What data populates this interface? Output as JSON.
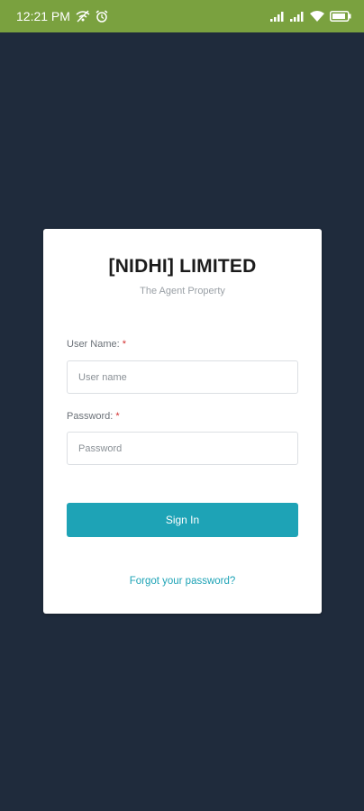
{
  "status_bar": {
    "time": "12:21 PM",
    "left_icons": [
      "wifi-off-icon",
      "alarm-icon"
    ],
    "right_icons": [
      "signal-icon",
      "signal-icon",
      "wifi-icon",
      "battery-icon"
    ],
    "background": "#7aa13f"
  },
  "login": {
    "title": "[NIDHI] LIMITED",
    "subtitle": "The Agent Property",
    "username_label": "User Name:",
    "username_placeholder": "User name",
    "password_label": "Password:",
    "password_placeholder": "Password",
    "required_marker": "*",
    "signin_label": "Sign In",
    "forgot_label": "Forgot your password?"
  },
  "colors": {
    "background": "#1f2b3c",
    "accent": "#1ea3b6",
    "required": "#d32f2f"
  }
}
